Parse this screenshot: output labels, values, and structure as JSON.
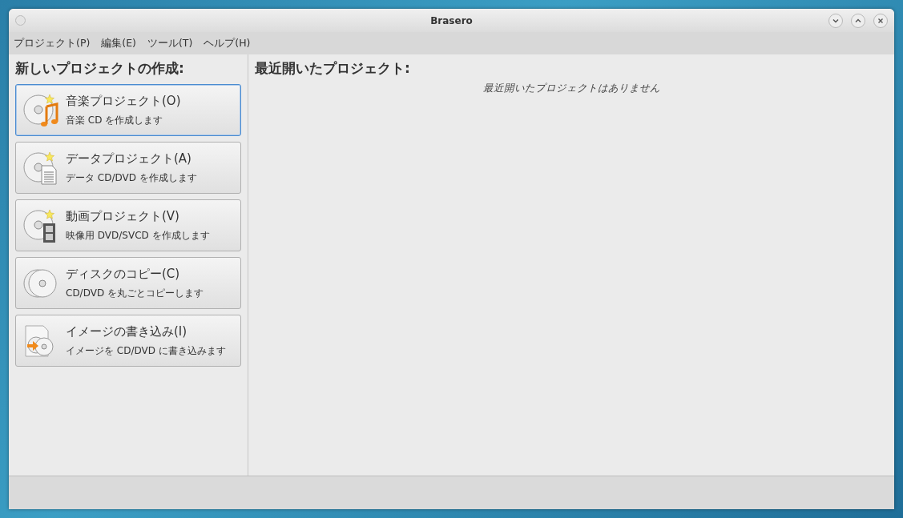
{
  "window": {
    "title": "Brasero"
  },
  "menu": [
    "プロジェクト(P)",
    "編集(E)",
    "ツール(T)",
    "ヘルプ(H)"
  ],
  "new_project": {
    "heading": "新しいプロジェクトの作成:",
    "buttons": [
      {
        "kind": "audio",
        "title": "音楽プロジェクト(O)",
        "subtitle": "音楽 CD を作成します",
        "selected": true
      },
      {
        "kind": "data",
        "title": "データプロジェクト(A)",
        "subtitle": "データ CD/DVD を作成します",
        "selected": false
      },
      {
        "kind": "video",
        "title": "動画プロジェクト(V)",
        "subtitle": "映像用 DVD/SVCD を作成します",
        "selected": false
      },
      {
        "kind": "copy",
        "title": "ディスクのコピー(C)",
        "subtitle": "CD/DVD を丸ごとコピーします",
        "selected": false
      },
      {
        "kind": "image",
        "title": "イメージの書き込み(I)",
        "subtitle": "イメージを CD/DVD に書き込みます",
        "selected": false
      }
    ]
  },
  "recent": {
    "heading": "最近開いたプロジェクト:",
    "empty_message": "最近開いたプロジェクトはありません"
  }
}
